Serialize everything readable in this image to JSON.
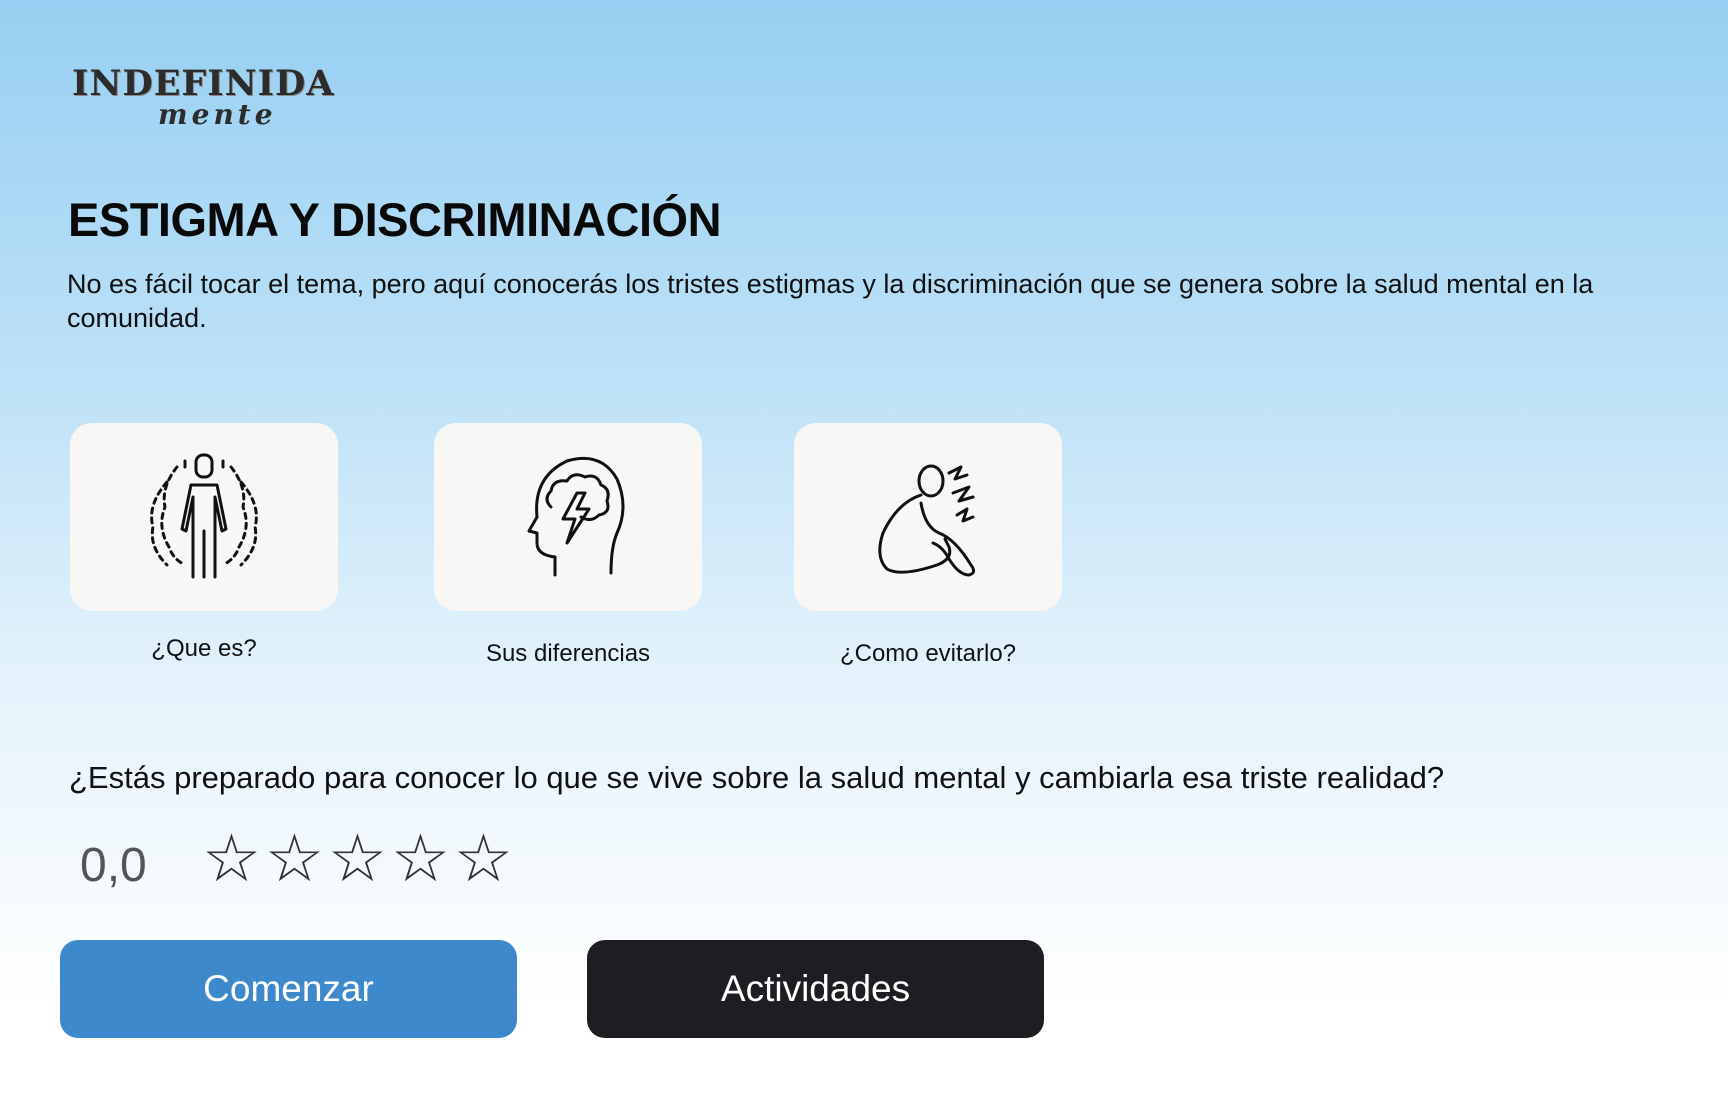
{
  "logo": {
    "line1": "INDEFINIDA",
    "line2": "mente"
  },
  "page": {
    "title": "ESTIGMA Y DISCRIMINACIÓN",
    "intro": "No es fácil tocar el tema, pero aquí conocerás los tristes estigmas y la discriminación que se genera sobre la salud mental en la comunidad."
  },
  "cards": [
    {
      "label": "¿Que es?",
      "icon": "person-aura-icon"
    },
    {
      "label": "Sus diferencias",
      "icon": "head-brain-lightning-icon"
    },
    {
      "label": "¿Como evitarlo?",
      "icon": "person-distress-icon"
    }
  ],
  "question": "¿Estás preparado para conocer lo que se vive sobre la salud mental y cambiarla esa triste realidad?",
  "rating": {
    "value": "0,0",
    "stars_total": 5,
    "stars_filled": 0,
    "star_glyph": "☆"
  },
  "buttons": {
    "start": "Comenzar",
    "activities": "Actividades"
  },
  "colors": {
    "primary_button": "#3d89cb",
    "secondary_button": "#1e1d21",
    "card_bg": "#f8f7f5",
    "gradient_top": "#97cff2",
    "gradient_bottom": "#ffffff"
  }
}
